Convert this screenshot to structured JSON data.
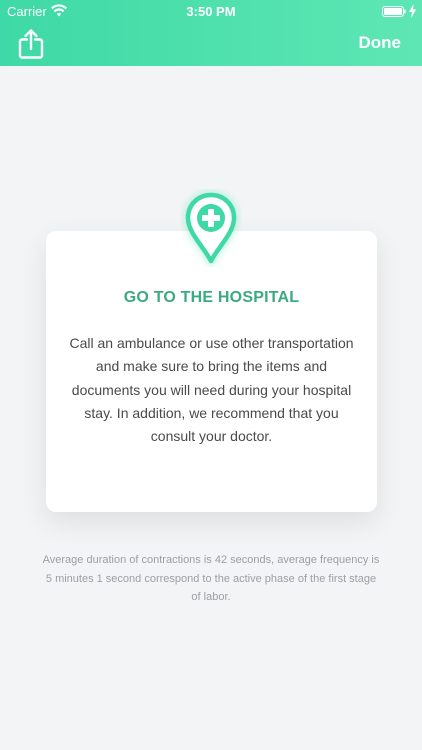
{
  "status_bar": {
    "carrier": "Carrier",
    "time": "3:50 PM"
  },
  "nav": {
    "share_icon": "share-icon",
    "done_label": "Done"
  },
  "card": {
    "icon": "hospital-pin-icon",
    "title": "GO TO THE HOSPITAL",
    "body": "Call an ambulance or use other transportation and make sure to bring the items and documents you will need during your hospital stay. In addition, we recommend that you consult your doctor."
  },
  "footnote": "Average duration of contractions is 42 seconds, average frequency is 5 minutes 1 second correspond to the active phase of the first stage of labor.",
  "colors": {
    "accent": "#3ed9a6",
    "title": "#3aaa80",
    "background": "#f3f4f6"
  }
}
